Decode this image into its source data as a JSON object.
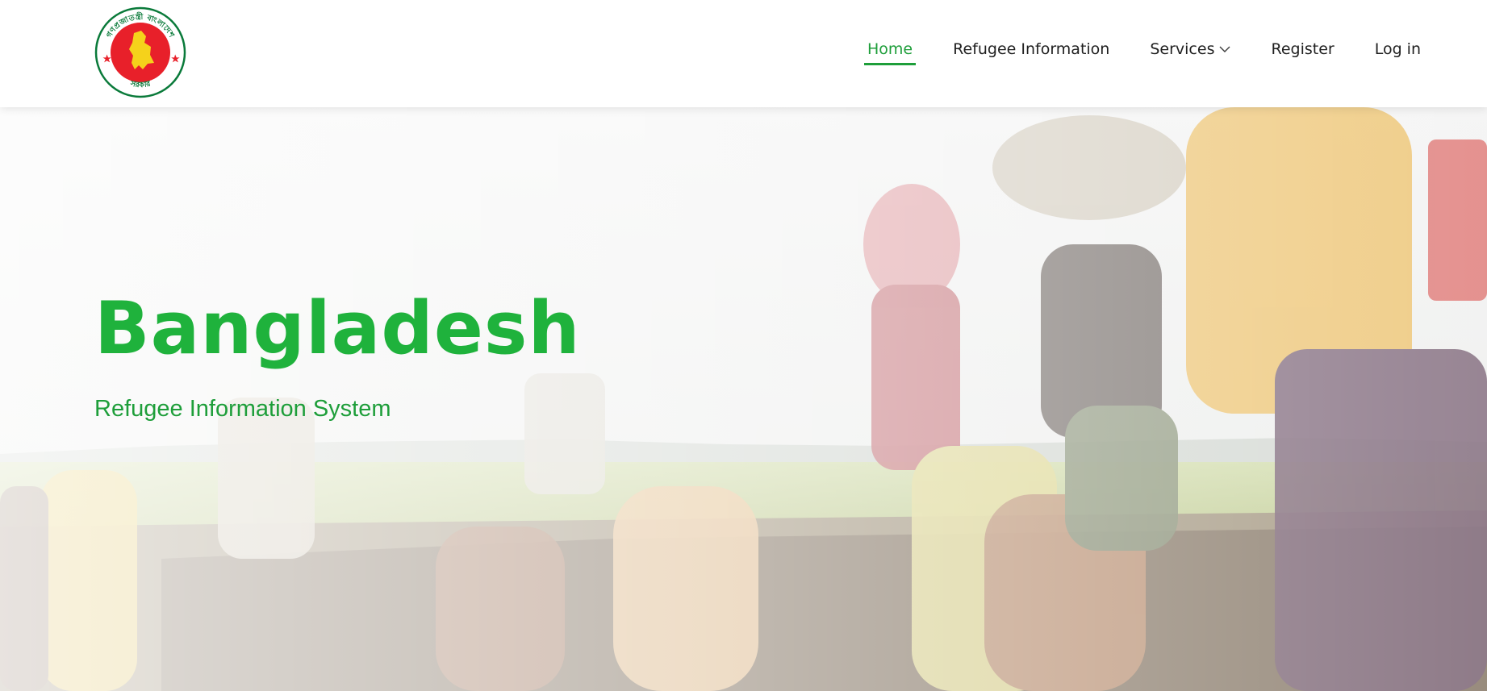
{
  "header": {
    "logo_alt": "Government of the People's Republic of Bangladesh emblem",
    "logo_text": "গণপ্রজাতন্ত্রী বাংলাদেশ সরকার",
    "nav": [
      {
        "label": "Home",
        "active": true
      },
      {
        "label": "Refugee Information",
        "active": false
      },
      {
        "label": "Services",
        "active": false,
        "icon": "chevron-down-icon"
      },
      {
        "label": "Register",
        "active": false
      },
      {
        "label": "Log in",
        "active": false
      }
    ]
  },
  "hero": {
    "title": "Bangladesh",
    "subtitle": "Refugee Information System",
    "image_description": "Refugees walking through fields carrying bundles"
  },
  "colors": {
    "brand_green": "#1fb23c",
    "nav_active": "#1e9e3a",
    "emblem_red": "#e8202a",
    "emblem_green": "#0a7a3a",
    "emblem_map": "#f5d21b"
  }
}
